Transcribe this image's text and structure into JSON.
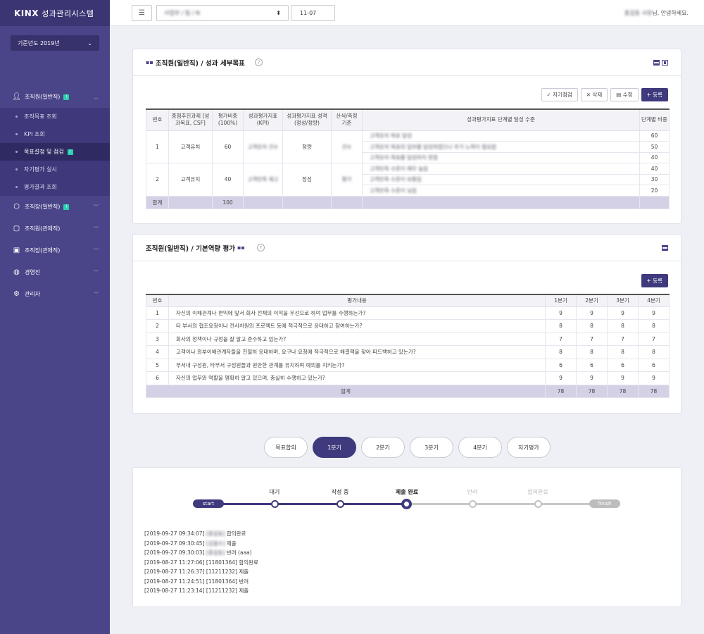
{
  "brand": {
    "logo": "KINX",
    "title": "성과관리시스템"
  },
  "year_select": {
    "value": "기준년도 2019년"
  },
  "sidebar": {
    "items": [
      {
        "label": "조직원(일반직)",
        "badge": "!",
        "expanded": true
      },
      {
        "label": "조직장(일반직)",
        "badge": "!"
      },
      {
        "label": "조직원(관제직)"
      },
      {
        "label": "조직장(관제직)"
      },
      {
        "label": "경영진"
      },
      {
        "label": "관리자"
      }
    ],
    "sub": [
      {
        "label": "조직목표 조회"
      },
      {
        "label": "KPI 조회"
      },
      {
        "label": "목표설정 및 점검",
        "badge": "!"
      },
      {
        "label": "자기평가 실시"
      },
      {
        "label": "평가결과 조회"
      }
    ]
  },
  "topbar": {
    "org_value": "사업부 / 팀 / N",
    "date_value": "11-07",
    "greeting_name": "홍길동 사원",
    "greeting_suffix": "님, 안녕하세요."
  },
  "panel1": {
    "title": "조직원(일반직) / 성과 세부목표",
    "buttons": {
      "self_check": "✓ 자기점검",
      "delete": "✕ 삭제",
      "edit": "▤ 수정",
      "register": "+ 등록"
    },
    "headers": [
      "번호",
      "중점추진과제 [성과목표, CSF]",
      "평가비중 (100%)",
      "성과평가지표 (KPI)",
      "성과평가지표 성격 (정성/정량)",
      "산식/측정 기준",
      "성과평가지표 단계별 달성 수준",
      "단계별 비중"
    ],
    "rows": [
      {
        "no": "1",
        "task": "고객유치",
        "weight": "60",
        "kpi": "고객유치 건수",
        "kind": "정량",
        "formula": "건수",
        "levels": [
          {
            "text": "고객유치 목표 달성",
            "w": "60"
          },
          {
            "text": "고객유치 목표의 일부를 달성하였으나 추가 노력이 필요함",
            "w": "50"
          },
          {
            "text": "고객유치 목표를 달성하지 못함",
            "w": "40"
          }
        ]
      },
      {
        "no": "2",
        "task": "고객유치",
        "weight": "40",
        "kpi": "고객만족 제고",
        "kind": "정성",
        "formula": "평가",
        "levels": [
          {
            "text": "고객만족 수준이 매우 높음",
            "w": "40"
          },
          {
            "text": "고객만족 수준이 보통임",
            "w": "30"
          },
          {
            "text": "고객만족 수준이 낮음",
            "w": "20"
          }
        ]
      }
    ],
    "total_label": "합계",
    "total_value": "100"
  },
  "panel2": {
    "title": "조직원(일반직) / 기본역량 평가",
    "register": "+ 등록",
    "headers": {
      "no": "번호",
      "content": "평가내용",
      "q1": "1분기",
      "q2": "2분기",
      "q3": "3분기",
      "q4": "4분기"
    },
    "rows": [
      {
        "no": "1",
        "content": "자신의 이해관계나 편익에 앞서 회사 전체의 이익을 우선으로 하여 업무를 수행하는가?",
        "q": [
          "9",
          "9",
          "9",
          "9"
        ]
      },
      {
        "no": "2",
        "content": "타 부서의 협조요청이나 전사차원의 프로젝트 등에 적극적으로 응대하고 참여하는가?",
        "q": [
          "8",
          "8",
          "8",
          "8"
        ]
      },
      {
        "no": "3",
        "content": "회사의 정책이나 규정을 잘 알고 준수하고 있는가?",
        "q": [
          "7",
          "7",
          "7",
          "7"
        ]
      },
      {
        "no": "4",
        "content": "고객이나 외부이해관계자들을 친절히 응대하며, 요구나 요청에 적극적으로 해결책을 찾아 피드백하고 있는가?",
        "q": [
          "8",
          "8",
          "8",
          "8"
        ]
      },
      {
        "no": "5",
        "content": "부서내 구성원, 타부서 구성원들과 원만한 관계를 유지하며 예의를 지키는가?",
        "q": [
          "6",
          "6",
          "6",
          "6"
        ]
      },
      {
        "no": "6",
        "content": "자신의 업무와 역할을 명확히 알고 있으며, 충실히 수행하고 있는가?",
        "q": [
          "9",
          "9",
          "9",
          "9"
        ]
      }
    ],
    "total_label": "합계",
    "totals": [
      "78",
      "78",
      "78",
      "78"
    ]
  },
  "tabs": [
    "목표합의",
    "1분기",
    "2분기",
    "3분기",
    "4분기",
    "자기평가"
  ],
  "active_tab": "1분기",
  "progress": {
    "start": "start",
    "finish": "finish",
    "steps": [
      {
        "label": "대기",
        "done": true
      },
      {
        "label": "작성 중",
        "done": true
      },
      {
        "label": "제출 완료",
        "done": true,
        "current": true
      },
      {
        "label": "반려",
        "done": false
      },
      {
        "label": "합의완료",
        "done": false
      }
    ]
  },
  "log": [
    {
      "ts": "[2019-09-27 09:34:07]",
      "who": "[홍길동]",
      "msg": "합의완료"
    },
    {
      "ts": "[2019-09-27 09:30:45]",
      "who": "[김철수]",
      "msg": "제출"
    },
    {
      "ts": "[2019-09-27 09:30:03]",
      "who": "[홍길동]",
      "msg": "반려 (aaa)"
    },
    {
      "ts": "[2019-08-27 11:27:06]",
      "who": "[11801364]",
      "msg": "합의완료"
    },
    {
      "ts": "[2019-08-27 11:26:37]",
      "who": "[11211232]",
      "msg": "제출"
    },
    {
      "ts": "[2019-08-27 11:24:51]",
      "who": "[11801364]",
      "msg": "반려"
    },
    {
      "ts": "[2019-08-27 11:23:14]",
      "who": "[11211232]",
      "msg": "제출"
    }
  ],
  "colors": {
    "primary": "#3f3a7d",
    "sidebar": "#4a4488",
    "accent_badge": "#2ad0b0",
    "sum_row": "#d4d1e6"
  }
}
